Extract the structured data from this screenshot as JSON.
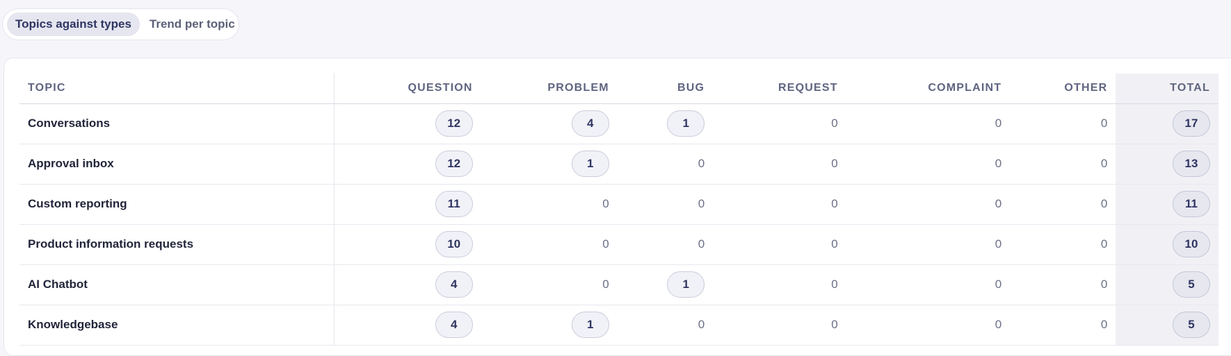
{
  "tabs": [
    {
      "label": "Topics against types",
      "active": true
    },
    {
      "label": "Trend per topic",
      "active": false
    }
  ],
  "table": {
    "columns": [
      "TOPIC",
      "QUESTION",
      "PROBLEM",
      "BUG",
      "REQUEST",
      "COMPLAINT",
      "OTHER",
      "TOTAL"
    ],
    "rows": [
      {
        "topic": "Conversations",
        "values": [
          12,
          4,
          1,
          0,
          0,
          0
        ],
        "total": 17
      },
      {
        "topic": "Approval inbox",
        "values": [
          12,
          1,
          0,
          0,
          0,
          0
        ],
        "total": 13
      },
      {
        "topic": "Custom reporting",
        "values": [
          11,
          0,
          0,
          0,
          0,
          0
        ],
        "total": 11
      },
      {
        "topic": "Product information requests",
        "values": [
          10,
          0,
          0,
          0,
          0,
          0
        ],
        "total": 10
      },
      {
        "topic": "AI Chatbot",
        "values": [
          4,
          0,
          1,
          0,
          0,
          0
        ],
        "total": 5
      },
      {
        "topic": "Knowledgebase",
        "values": [
          4,
          1,
          0,
          0,
          0,
          0
        ],
        "total": 5
      }
    ]
  }
}
